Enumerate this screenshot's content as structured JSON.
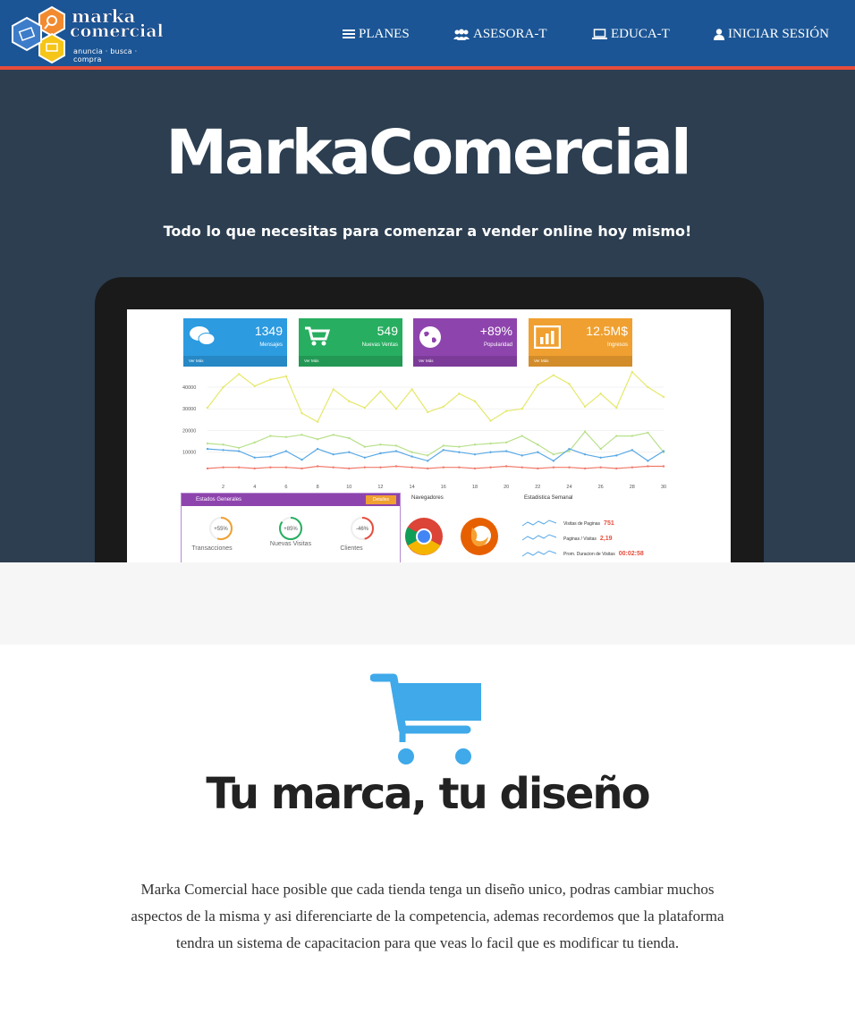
{
  "navbar": {
    "logo": {
      "line1": "marka",
      "line2": "comercial",
      "tagline": "anuncia · busca · compra"
    },
    "items": [
      {
        "label": "PLANES",
        "icon": "bars-icon"
      },
      {
        "label": "ASESORA-T",
        "icon": "users-icon"
      },
      {
        "label": "EDUCA-T",
        "icon": "laptop-icon"
      },
      {
        "label": "INICIAR SESIÓN",
        "icon": "user-icon"
      }
    ]
  },
  "hero": {
    "title": "MarkaComercial",
    "subtitle": "Todo lo que necesitas para comenzar a vender online hoy mismo!"
  },
  "dashboard": {
    "cards": [
      {
        "value": "1349",
        "label": "Mensajes",
        "footer": "Ver Más",
        "color": "#2c9be0",
        "icon": "comments-icon"
      },
      {
        "value": "549",
        "label": "Nuevas Ventas",
        "footer": "Ver Más",
        "color": "#27ae60",
        "icon": "cart-icon"
      },
      {
        "value": "+89%",
        "label": "Popularidad",
        "footer": "Ver Más",
        "color": "#8e44ad",
        "icon": "globe-icon"
      },
      {
        "value": "12.5M$",
        "label": "Ingresos",
        "footer": "Ver Más",
        "color": "#f0a030",
        "icon": "bar-chart-icon"
      }
    ],
    "stats": {
      "title": "Estados Generales",
      "button": "Detalles",
      "items": [
        {
          "value": "+55%",
          "label": "Transacciones",
          "pct": 0.55,
          "color": "#f0a030"
        },
        {
          "value": "+85%",
          "label": "Nuevas Visitas",
          "pct": 0.85,
          "color": "#27ae60"
        },
        {
          "value": "-46%",
          "label": "Clientes",
          "pct": 0.46,
          "color": "#e74c3c"
        }
      ]
    },
    "browsers": {
      "title": "Navegadores",
      "items": [
        "chrome-icon",
        "firefox-icon"
      ]
    },
    "weekly": {
      "title": "Estadistica Semanal",
      "rows": [
        {
          "label": "Visitas de Paginas",
          "value": "751"
        },
        {
          "label": "Paginas / Visitas",
          "value": "2,19"
        },
        {
          "label": "Prom. Duracion de Visitas",
          "value": "00:02:58"
        }
      ]
    }
  },
  "chart_data": {
    "type": "line",
    "x": [
      1,
      2,
      3,
      4,
      5,
      6,
      7,
      8,
      9,
      10,
      11,
      12,
      13,
      14,
      15,
      16,
      17,
      18,
      19,
      20,
      21,
      22,
      23,
      24,
      25,
      26,
      27,
      28,
      29,
      30
    ],
    "x_ticks": [
      "2",
      "4",
      "6",
      "8",
      "10",
      "12",
      "14",
      "16",
      "18",
      "20",
      "22",
      "24",
      "26",
      "28",
      "30"
    ],
    "y_ticks": [
      "10000",
      "20000",
      "30000",
      "40000"
    ],
    "ylim": [
      0,
      47000
    ],
    "grid": true,
    "series": [
      {
        "color": "#e5e86a",
        "values": [
          30500,
          40000,
          46000,
          40500,
          43500,
          45000,
          28000,
          24000,
          39000,
          33500,
          30500,
          38000,
          30000,
          39000,
          28500,
          31000,
          37000,
          33500,
          24500,
          29000,
          30000,
          41000,
          45500,
          41500,
          31000,
          37000,
          30500,
          47000,
          40000,
          35500
        ]
      },
      {
        "color": "#b8e08a",
        "values": [
          14000,
          13500,
          12000,
          14500,
          17500,
          17000,
          18000,
          16000,
          18000,
          16500,
          12500,
          13500,
          13000,
          10000,
          8500,
          13000,
          12500,
          13500,
          14000,
          14500,
          17500,
          13500,
          9000,
          10500,
          19500,
          11500,
          17500,
          17500,
          19000,
          10000
        ]
      },
      {
        "color": "#5aa9e6",
        "values": [
          11500,
          11000,
          10500,
          7500,
          8000,
          10500,
          6500,
          11500,
          9000,
          10000,
          7500,
          9500,
          10500,
          8000,
          6000,
          11000,
          10000,
          9000,
          10000,
          10500,
          8500,
          10000,
          6000,
          11500,
          9000,
          7500,
          8500,
          11000,
          6000,
          10500
        ]
      },
      {
        "color": "#f07a6a",
        "values": [
          2500,
          3000,
          3000,
          2500,
          3000,
          3000,
          2500,
          3500,
          3000,
          2500,
          3000,
          3000,
          3500,
          3000,
          2500,
          3000,
          3000,
          2500,
          3000,
          3500,
          3000,
          2500,
          3000,
          3000,
          2500,
          3000,
          2500,
          3000,
          3500,
          3500
        ]
      }
    ]
  },
  "feature": {
    "title": "Tu marca, tu diseño",
    "text": "Marka Comercial hace posible que cada tienda tenga un diseño unico, podras cambiar muchos aspectos de la misma y asi diferenciarte de la competencia, ademas recordemos que la plataforma tendra un sistema de capacitacion para que veas lo facil que es modificar tu tienda."
  },
  "colors": {
    "navbar": "#1b5595",
    "nav_border": "#e74c3c",
    "hero_bg": "#2c3e50",
    "cart": "#3fa9e9"
  }
}
